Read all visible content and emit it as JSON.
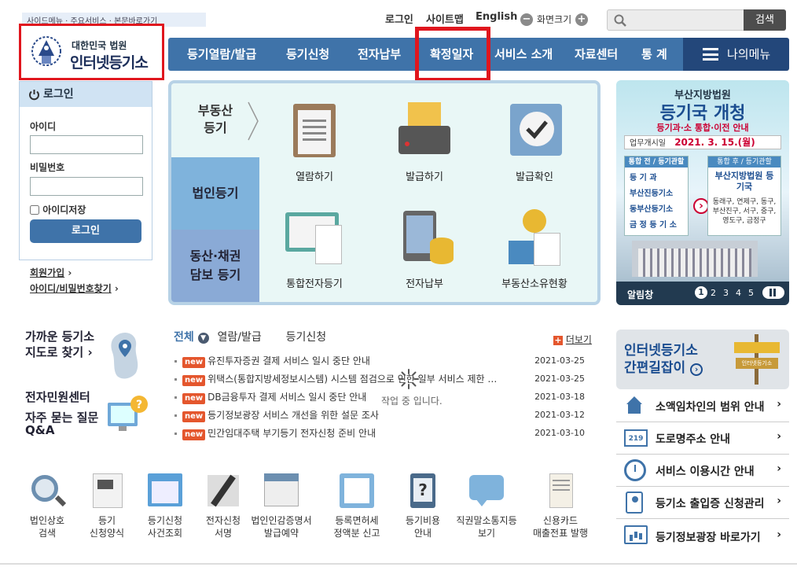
{
  "skip_links": "사이드메뉴 · 주요서비스 · 본문바로가기",
  "logo": {
    "small": "대한민국 법원",
    "big": "인터넷등기소"
  },
  "util": {
    "login": "로그인",
    "sitemap": "사이트맵",
    "english": "English",
    "font_size": "화면크기",
    "minus": "−",
    "plus": "+"
  },
  "search": {
    "button": "검색",
    "placeholder": ""
  },
  "nav": {
    "items": [
      "등기열람/발급",
      "등기신청",
      "전자납부",
      "확정일자",
      "서비스 소개",
      "자료센터",
      "통  계"
    ],
    "my_menu": "나의메뉴"
  },
  "login": {
    "title": "로그인",
    "id_label": "아이디",
    "pw_label": "비밀번호",
    "save_id": "아이디저장",
    "button": "로그인",
    "join": "회원가입",
    "find": "아이디/비밀번호찾기"
  },
  "center": {
    "tabs": [
      "부동산\n등기",
      "법인등기",
      "동산·채권\n담보 등기"
    ],
    "services": [
      "열람하기",
      "발급하기",
      "발급확인",
      "통합전자등기",
      "전자납부",
      "부동산소유현황"
    ]
  },
  "banner": {
    "court": "부산지방법원",
    "headline": "등기국 개청",
    "sub": "등기과·소 통합·이전 안내",
    "date_label": "업무개시일",
    "date": "2021. 3. 15.(월)",
    "left_head": "통합 전 / 등기관할",
    "left_items": [
      "등 기 과",
      "부산진등기소",
      "동부산등기소",
      "금 정 등 기 소"
    ],
    "right_head": "통합 후 / 등기관할",
    "right_title": "부산지방법원 등기국",
    "right_desc": "동래구, 연제구, 동구, 부산진구, 서구, 중구, 영도구, 금정구",
    "bar_label": "알림창",
    "pages": [
      "1",
      "2",
      "3",
      "4",
      "5"
    ]
  },
  "nearby": {
    "line1": "가까운 등기소",
    "line2": "지도로 찾기"
  },
  "civil": {
    "line1": "전자민원센터",
    "line2": "자주 묻는 질문",
    "line3": "Q&A"
  },
  "news": {
    "tabs": [
      "전체",
      "열람/발급",
      "등기신청"
    ],
    "more": "더보기",
    "badge": "new",
    "loading": "작업 중 입니다.",
    "items": [
      {
        "title": "유진투자증권 결제 서비스 일시 중단 안내",
        "date": "2021-03-25"
      },
      {
        "title": "위택스(통합지방세정보시스템) 시스템 점검으로 인한 일부 서비스 제한 …",
        "date": "2021-03-25"
      },
      {
        "title": "DB금융투자 결제 서비스 일시 중단 안내",
        "date": "2021-03-18"
      },
      {
        "title": "등기정보광장 서비스 개선을 위한 설문 조사",
        "date": "2021-03-12"
      },
      {
        "title": "민간임대주택 부기등기 전자신청 준비 안내",
        "date": "2021-03-10"
      }
    ]
  },
  "quick": {
    "guide_line1": "인터넷등기소",
    "guide_line2": "간편길잡이",
    "sign_text": "인터넷등기소",
    "rows": [
      "소액임차인의 범위 안내",
      "도로명주소 안내",
      "서비스 이용시간 안내",
      "등기소 출입증 신청관리",
      "등기정보광장 바로가기"
    ]
  },
  "bottom": [
    {
      "l1": "법인상호",
      "l2": "검색"
    },
    {
      "l1": "등기",
      "l2": "신청양식"
    },
    {
      "l1": "등기신청",
      "l2": "사건조회"
    },
    {
      "l1": "전자신청",
      "l2": "서명"
    },
    {
      "l1": "법인인감증명서",
      "l2": "발급예약"
    },
    {
      "l1": "등록면허세",
      "l2": "정액분 신고"
    },
    {
      "l1": "등기비용",
      "l2": "안내"
    },
    {
      "l1": "직권말소통지등",
      "l2": "보기"
    },
    {
      "l1": "신용카드",
      "l2": "매출전표 발행"
    }
  ],
  "colors": {
    "nav": "#3f73a9",
    "my_menu": "#23477a",
    "highlight": "#e0161e",
    "new_badge": "#e4562d"
  }
}
